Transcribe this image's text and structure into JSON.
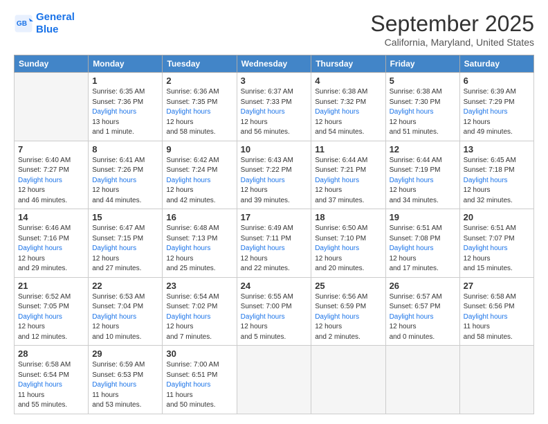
{
  "logo": {
    "line1": "General",
    "line2": "Blue"
  },
  "title": "September 2025",
  "subtitle": "California, Maryland, United States",
  "days_of_week": [
    "Sunday",
    "Monday",
    "Tuesday",
    "Wednesday",
    "Thursday",
    "Friday",
    "Saturday"
  ],
  "weeks": [
    [
      {
        "num": "",
        "info": "",
        "empty": true
      },
      {
        "num": "1",
        "sunrise": "Sunrise: 6:35 AM",
        "sunset": "Sunset: 7:36 PM",
        "daylight": "Daylight: 13 hours and 1 minute."
      },
      {
        "num": "2",
        "sunrise": "Sunrise: 6:36 AM",
        "sunset": "Sunset: 7:35 PM",
        "daylight": "Daylight: 12 hours and 58 minutes."
      },
      {
        "num": "3",
        "sunrise": "Sunrise: 6:37 AM",
        "sunset": "Sunset: 7:33 PM",
        "daylight": "Daylight: 12 hours and 56 minutes."
      },
      {
        "num": "4",
        "sunrise": "Sunrise: 6:38 AM",
        "sunset": "Sunset: 7:32 PM",
        "daylight": "Daylight: 12 hours and 54 minutes."
      },
      {
        "num": "5",
        "sunrise": "Sunrise: 6:38 AM",
        "sunset": "Sunset: 7:30 PM",
        "daylight": "Daylight: 12 hours and 51 minutes."
      },
      {
        "num": "6",
        "sunrise": "Sunrise: 6:39 AM",
        "sunset": "Sunset: 7:29 PM",
        "daylight": "Daylight: 12 hours and 49 minutes."
      }
    ],
    [
      {
        "num": "7",
        "sunrise": "Sunrise: 6:40 AM",
        "sunset": "Sunset: 7:27 PM",
        "daylight": "Daylight: 12 hours and 46 minutes."
      },
      {
        "num": "8",
        "sunrise": "Sunrise: 6:41 AM",
        "sunset": "Sunset: 7:26 PM",
        "daylight": "Daylight: 12 hours and 44 minutes."
      },
      {
        "num": "9",
        "sunrise": "Sunrise: 6:42 AM",
        "sunset": "Sunset: 7:24 PM",
        "daylight": "Daylight: 12 hours and 42 minutes."
      },
      {
        "num": "10",
        "sunrise": "Sunrise: 6:43 AM",
        "sunset": "Sunset: 7:22 PM",
        "daylight": "Daylight: 12 hours and 39 minutes."
      },
      {
        "num": "11",
        "sunrise": "Sunrise: 6:44 AM",
        "sunset": "Sunset: 7:21 PM",
        "daylight": "Daylight: 12 hours and 37 minutes."
      },
      {
        "num": "12",
        "sunrise": "Sunrise: 6:44 AM",
        "sunset": "Sunset: 7:19 PM",
        "daylight": "Daylight: 12 hours and 34 minutes."
      },
      {
        "num": "13",
        "sunrise": "Sunrise: 6:45 AM",
        "sunset": "Sunset: 7:18 PM",
        "daylight": "Daylight: 12 hours and 32 minutes."
      }
    ],
    [
      {
        "num": "14",
        "sunrise": "Sunrise: 6:46 AM",
        "sunset": "Sunset: 7:16 PM",
        "daylight": "Daylight: 12 hours and 29 minutes."
      },
      {
        "num": "15",
        "sunrise": "Sunrise: 6:47 AM",
        "sunset": "Sunset: 7:15 PM",
        "daylight": "Daylight: 12 hours and 27 minutes."
      },
      {
        "num": "16",
        "sunrise": "Sunrise: 6:48 AM",
        "sunset": "Sunset: 7:13 PM",
        "daylight": "Daylight: 12 hours and 25 minutes."
      },
      {
        "num": "17",
        "sunrise": "Sunrise: 6:49 AM",
        "sunset": "Sunset: 7:11 PM",
        "daylight": "Daylight: 12 hours and 22 minutes."
      },
      {
        "num": "18",
        "sunrise": "Sunrise: 6:50 AM",
        "sunset": "Sunset: 7:10 PM",
        "daylight": "Daylight: 12 hours and 20 minutes."
      },
      {
        "num": "19",
        "sunrise": "Sunrise: 6:51 AM",
        "sunset": "Sunset: 7:08 PM",
        "daylight": "Daylight: 12 hours and 17 minutes."
      },
      {
        "num": "20",
        "sunrise": "Sunrise: 6:51 AM",
        "sunset": "Sunset: 7:07 PM",
        "daylight": "Daylight: 12 hours and 15 minutes."
      }
    ],
    [
      {
        "num": "21",
        "sunrise": "Sunrise: 6:52 AM",
        "sunset": "Sunset: 7:05 PM",
        "daylight": "Daylight: 12 hours and 12 minutes."
      },
      {
        "num": "22",
        "sunrise": "Sunrise: 6:53 AM",
        "sunset": "Sunset: 7:04 PM",
        "daylight": "Daylight: 12 hours and 10 minutes."
      },
      {
        "num": "23",
        "sunrise": "Sunrise: 6:54 AM",
        "sunset": "Sunset: 7:02 PM",
        "daylight": "Daylight: 12 hours and 7 minutes."
      },
      {
        "num": "24",
        "sunrise": "Sunrise: 6:55 AM",
        "sunset": "Sunset: 7:00 PM",
        "daylight": "Daylight: 12 hours and 5 minutes."
      },
      {
        "num": "25",
        "sunrise": "Sunrise: 6:56 AM",
        "sunset": "Sunset: 6:59 PM",
        "daylight": "Daylight: 12 hours and 2 minutes."
      },
      {
        "num": "26",
        "sunrise": "Sunrise: 6:57 AM",
        "sunset": "Sunset: 6:57 PM",
        "daylight": "Daylight: 12 hours and 0 minutes."
      },
      {
        "num": "27",
        "sunrise": "Sunrise: 6:58 AM",
        "sunset": "Sunset: 6:56 PM",
        "daylight": "Daylight: 11 hours and 58 minutes."
      }
    ],
    [
      {
        "num": "28",
        "sunrise": "Sunrise: 6:58 AM",
        "sunset": "Sunset: 6:54 PM",
        "daylight": "Daylight: 11 hours and 55 minutes."
      },
      {
        "num": "29",
        "sunrise": "Sunrise: 6:59 AM",
        "sunset": "Sunset: 6:53 PM",
        "daylight": "Daylight: 11 hours and 53 minutes."
      },
      {
        "num": "30",
        "sunrise": "Sunrise: 7:00 AM",
        "sunset": "Sunset: 6:51 PM",
        "daylight": "Daylight: 11 hours and 50 minutes."
      },
      {
        "num": "",
        "info": "",
        "empty": true
      },
      {
        "num": "",
        "info": "",
        "empty": true
      },
      {
        "num": "",
        "info": "",
        "empty": true
      },
      {
        "num": "",
        "info": "",
        "empty": true
      }
    ]
  ]
}
